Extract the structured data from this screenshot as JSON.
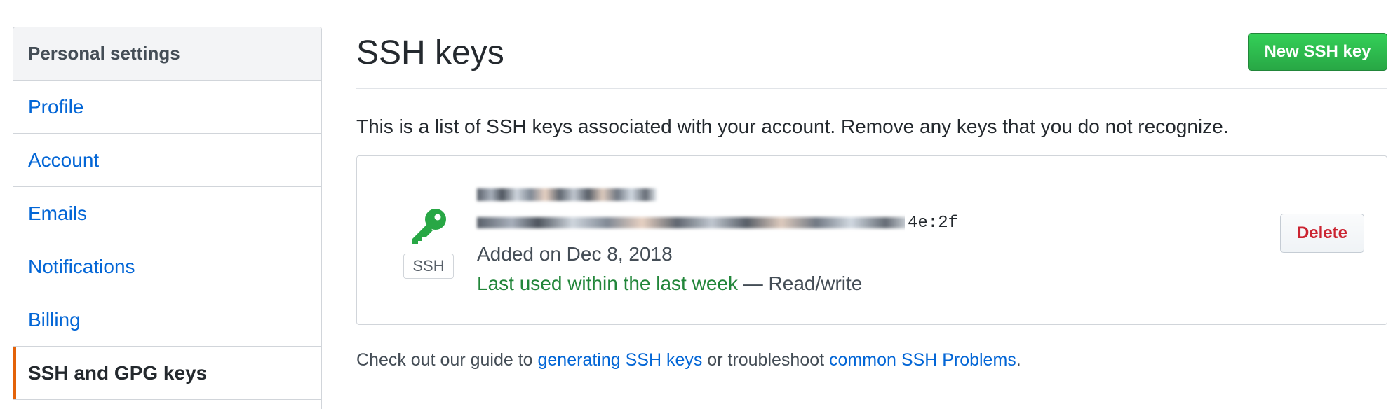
{
  "sidebar": {
    "heading": "Personal settings",
    "items": [
      {
        "label": "Profile"
      },
      {
        "label": "Account"
      },
      {
        "label": "Emails"
      },
      {
        "label": "Notifications"
      },
      {
        "label": "Billing"
      },
      {
        "label": "SSH and GPG keys",
        "active": true
      }
    ]
  },
  "main": {
    "title": "SSH keys",
    "new_button_label": "New SSH key",
    "intro": "This is a list of SSH keys associated with your account. Remove any keys that you do not recognize.",
    "key": {
      "icon": "key-icon",
      "badge": "SSH",
      "fingerprint_tail": "4e:2f",
      "added": "Added on Dec 8, 2018",
      "last_used": "Last used within the last week",
      "access": " — Read/write",
      "delete_label": "Delete"
    },
    "guide": {
      "prefix": "Check out our guide to ",
      "link1": "generating SSH keys",
      "middle": " or troubleshoot ",
      "link2": "common SSH Problems",
      "suffix": "."
    }
  },
  "colors": {
    "link": "#0366d6",
    "green": "#28a745",
    "danger": "#cb2431",
    "active_marker": "#e36209"
  }
}
